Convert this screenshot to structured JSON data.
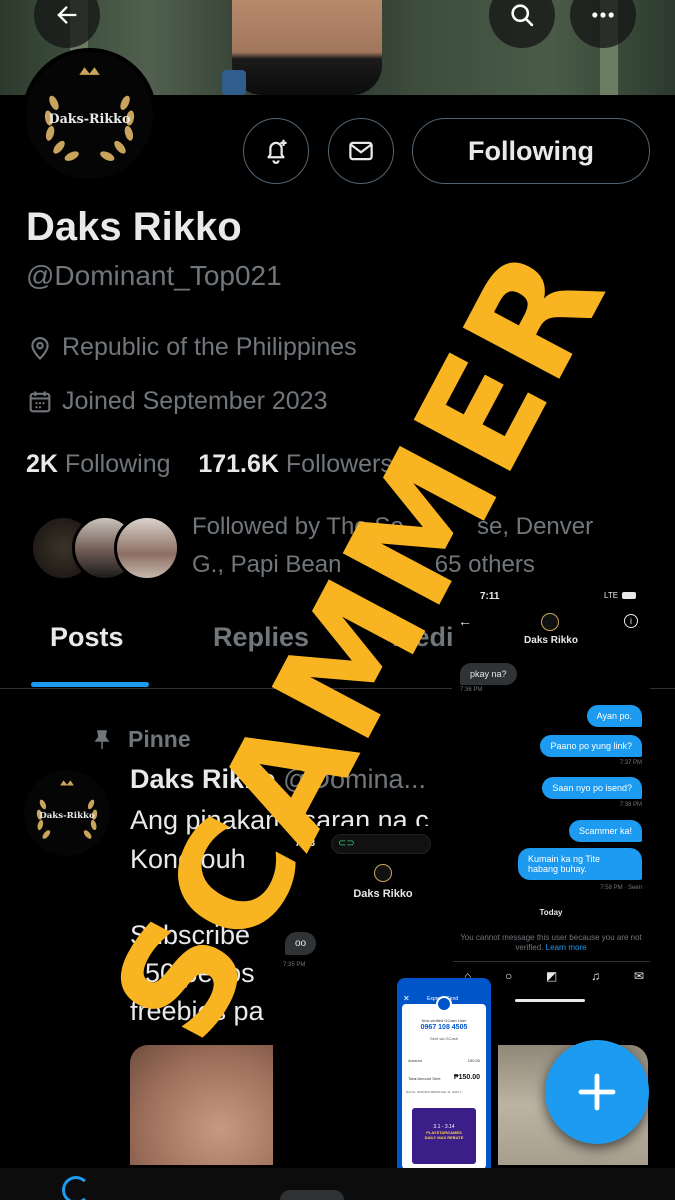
{
  "profile": {
    "name": "Daks Rikko",
    "handle": "@Dominant_Top021",
    "location": "Republic of the Philippines",
    "joined": "Joined September 2023",
    "following_count": "2K",
    "following_label": "Following",
    "followers_count": "171.6K",
    "followers_label": "Followers",
    "followed_by": "Followed by The So[…]se, Denver G., Papi Bean […] 65 others",
    "followed_by_line1": "Followed by The So",
    "followed_by_line1b": "se, Denver",
    "followed_by_line2": "G., Papi Bean",
    "followed_by_line2b": "65 others",
    "logo_text": "Daks-Rikko"
  },
  "header": {
    "follow_button": "Following",
    "back_icon": "back-arrow-icon",
    "search_icon": "search-icon",
    "more_icon": "more-icon"
  },
  "tabs": [
    {
      "label": "Posts",
      "active": true
    },
    {
      "label": "Replies",
      "active": false
    },
    {
      "label": "Medi",
      "active": false
    }
  ],
  "post": {
    "pinned_label": "Pinne",
    "author": "Daks Rikko",
    "handle": "@Domina...",
    "line1": "Ang pinakamasaran na c",
    "line2": "Kono ouh",
    "line3": "Subscribe",
    "line4": "250 pesos",
    "line5": "freebies pa"
  },
  "overlay": {
    "stamp": "SCAMMER",
    "stamp_color": "#f9b521"
  },
  "chat1": {
    "time": "7:11",
    "signal": "LTE",
    "title": "Daks Rikko",
    "messages": [
      {
        "from": "them",
        "text": "pkay na?",
        "stamp": "7:36 PM"
      },
      {
        "from": "me",
        "text": "Ayan po."
      },
      {
        "from": "me",
        "text": "Paano po yung link?",
        "stamp": "7:37 PM"
      },
      {
        "from": "me",
        "text": "Saan nyo po isend?",
        "stamp": "7:38 PM"
      },
      {
        "from": "me",
        "text": "Scammer ka!"
      },
      {
        "from": "me",
        "text": "Kumain ka ng  Tite habang buhay.",
        "stamp": "7:58 PM · Seen"
      }
    ],
    "day_label": "Today",
    "notice": "You cannot message this user because you are not verified.",
    "learn_more": "Learn more"
  },
  "chat2": {
    "time": "7:43",
    "title": "Daks Rikko",
    "message": "oo",
    "stamp": "7:35 PM"
  },
  "gcash": {
    "header": "Express Send",
    "user_label": "Non-verified GCash User",
    "number": "0967 108 4505",
    "via": "Sent via GCash",
    "amount_label": "Amount",
    "amount": "150.00",
    "total_label": "Total Amount Sent",
    "total": "₱150.00",
    "ref": "Ref No. 6019 062 282263  Mar 11, 2024 7:...",
    "promo1": "3.1 - 3.14",
    "promo2": "PLAYSTARGAMES",
    "promo3": "DAILY MAX REBATE"
  },
  "colors": {
    "accent": "#1d9bf0",
    "muted": "#71767b",
    "text": "#e7e9ea",
    "stamp": "#f9b521"
  }
}
